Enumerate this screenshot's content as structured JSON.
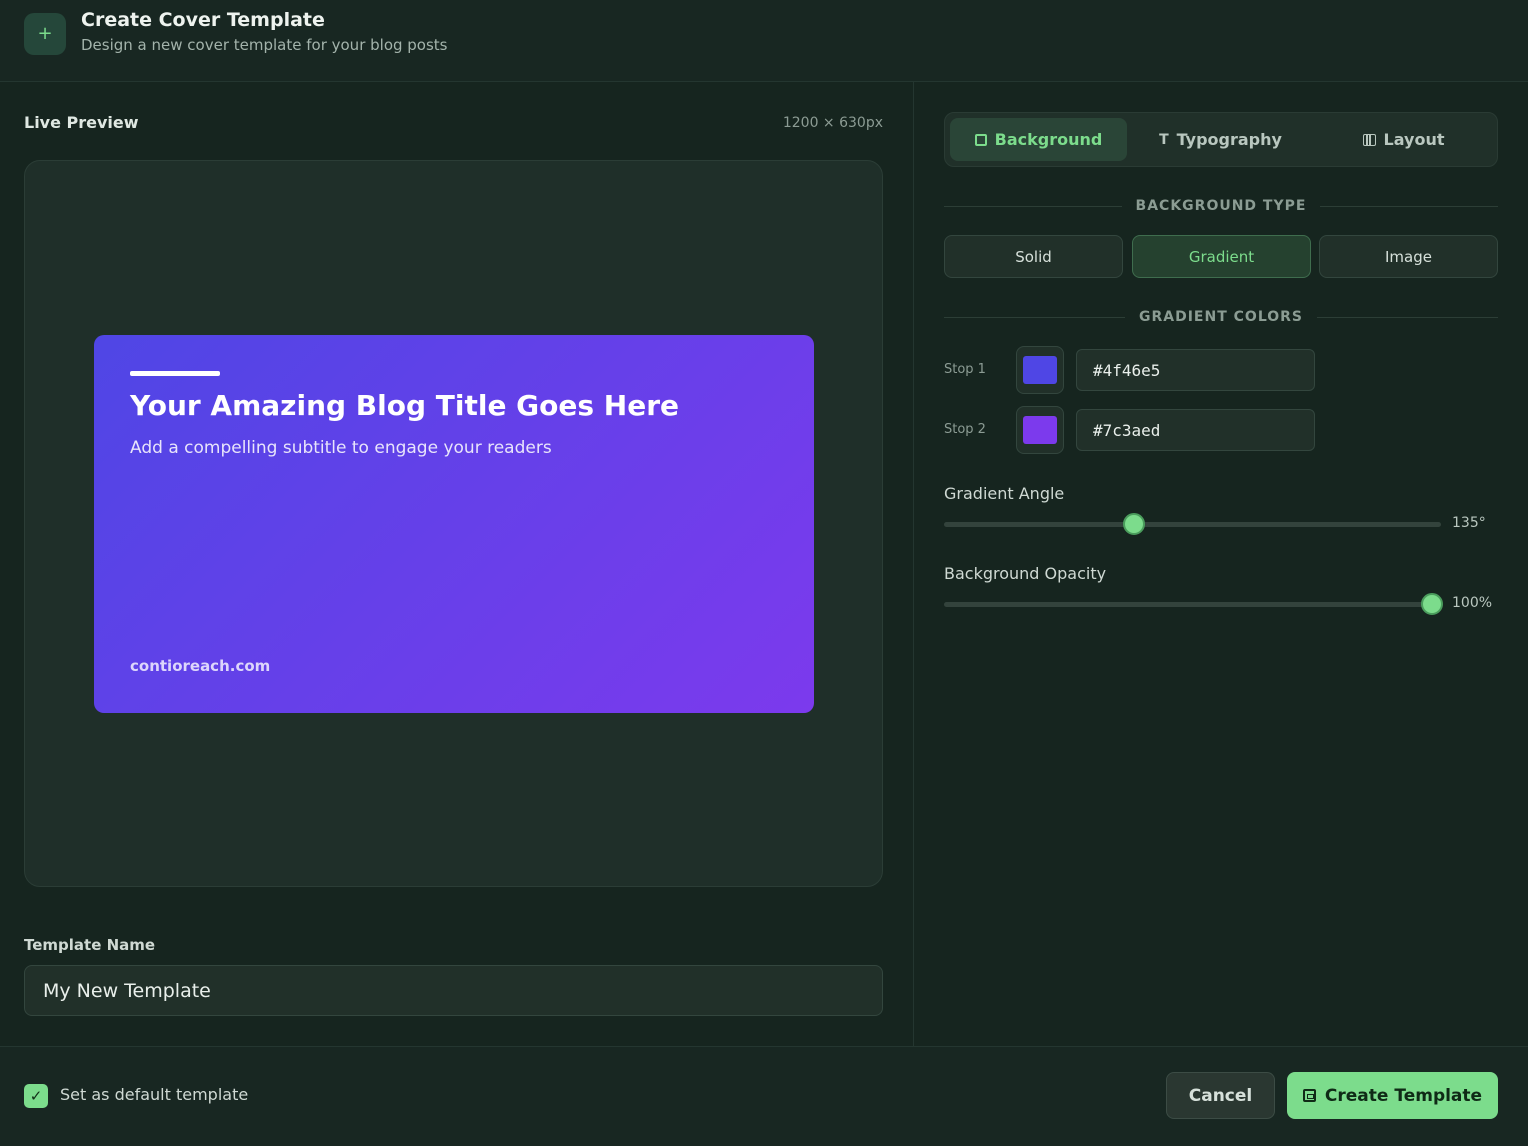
{
  "header": {
    "icon": "plus-icon",
    "title": "Create Cover Template",
    "subtitle": "Design a new cover template for your blog posts"
  },
  "preview": {
    "label": "Live Preview",
    "size": "1200 × 630px",
    "cover": {
      "title": "Your Amazing Blog Title Goes Here",
      "subtitle": "Add a compelling subtitle to engage your readers",
      "domain": "contioreach.com"
    }
  },
  "template_name": {
    "label": "Template Name",
    "value": "My New Template"
  },
  "tabs": [
    {
      "label": "Background",
      "icon": "square-icon",
      "active": true
    },
    {
      "label": "Typography",
      "icon": "type-icon",
      "active": false
    },
    {
      "label": "Layout",
      "icon": "columns-icon",
      "active": false
    }
  ],
  "background": {
    "type_title": "BACKGROUND TYPE",
    "types": [
      {
        "label": "Solid",
        "active": false
      },
      {
        "label": "Gradient",
        "active": true
      },
      {
        "label": "Image",
        "active": false
      }
    ],
    "colors_title": "GRADIENT COLORS",
    "stops": [
      {
        "label": "Stop 1",
        "color": "#4f46e5",
        "value": "#4f46e5"
      },
      {
        "label": "Stop 2",
        "color": "#7c3aed",
        "value": "#7c3aed"
      }
    ],
    "angle": {
      "label": "Gradient Angle",
      "value": "135°",
      "fraction": 0.375
    },
    "opacity": {
      "label": "Background Opacity",
      "value": "100%",
      "fraction": 1.0
    }
  },
  "footer": {
    "default_checked": true,
    "default_label": "Set as default template",
    "cancel_label": "Cancel",
    "create_label": "Create Template"
  },
  "colors": {
    "accent": "#7cdc8c",
    "background": "#16251f"
  }
}
